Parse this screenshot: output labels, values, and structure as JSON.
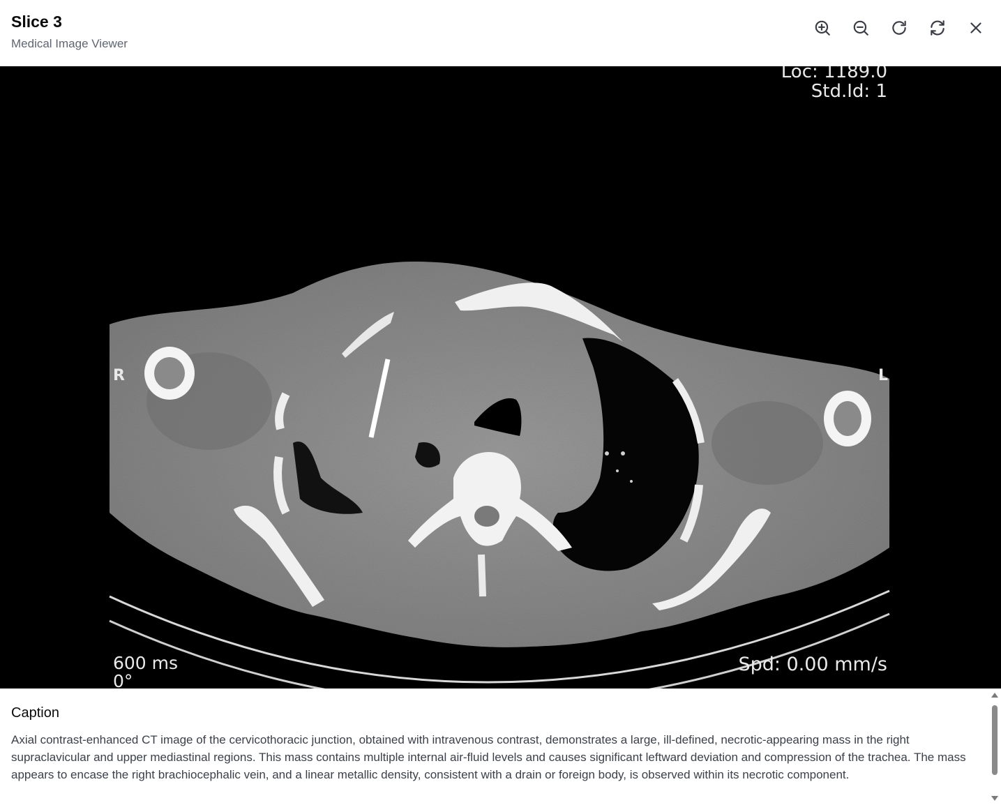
{
  "header": {
    "title": "Slice 3",
    "subtitle": "Medical Image Viewer"
  },
  "toolbar": {
    "buttons": [
      {
        "name": "zoom-in",
        "icon": "zoom-in-icon"
      },
      {
        "name": "zoom-out",
        "icon": "zoom-out-icon"
      },
      {
        "name": "rotate",
        "icon": "rotate-cw-icon"
      },
      {
        "name": "reset",
        "icon": "refresh-icon"
      },
      {
        "name": "close",
        "icon": "close-icon"
      }
    ]
  },
  "viewer": {
    "overlay": {
      "loc": "Loc: 1189.0",
      "std_id": "Std.Id: 1",
      "side_right": "R",
      "side_left": "L",
      "exposure": "600 ms",
      "angle": "0°",
      "speed": "Spd: 0.00 mm/s"
    }
  },
  "caption": {
    "heading": "Caption",
    "text": "Axial contrast-enhanced CT image of the cervicothoracic junction, obtained with intravenous contrast, demonstrates a large, ill-defined, necrotic-appearing mass in the right supraclavicular and upper mediastinal regions. This mass contains multiple internal air-fluid levels and causes significant leftward deviation and compression of the trachea. The mass appears to encase the right brachiocephalic vein, and a linear metallic density, consistent with a drain or foreign body, is observed within its necrotic component."
  },
  "colors": {
    "viewer_background": "#000000",
    "soft_tissue": "#8c8c8c",
    "bone": "#f2f2f2"
  }
}
